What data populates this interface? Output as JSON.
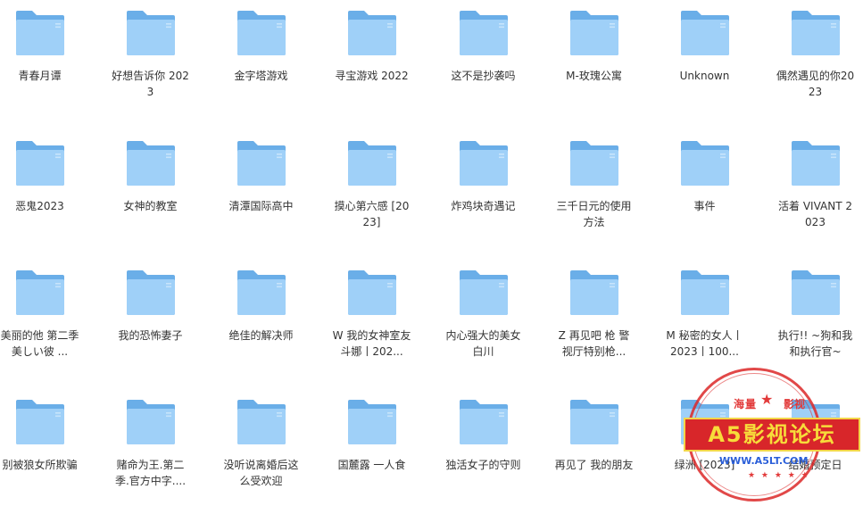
{
  "folders": [
    {
      "label": "青春月谭"
    },
    {
      "label": "好想告诉你 2023"
    },
    {
      "label": "金字塔游戏"
    },
    {
      "label": "寻宝游戏 2022"
    },
    {
      "label": "这不是抄袭吗"
    },
    {
      "label": "M-玫瑰公寓"
    },
    {
      "label": "Unknown"
    },
    {
      "label": "偶然遇见的你2023"
    },
    {
      "label": "恶鬼2023"
    },
    {
      "label": "女神的教室"
    },
    {
      "label": "清潭国际高中"
    },
    {
      "label": "摸心第六感 [2023]"
    },
    {
      "label": "炸鸡块奇遇记"
    },
    {
      "label": "三千日元的使用方法"
    },
    {
      "label": "事件"
    },
    {
      "label": "活着 VIVANT 2023"
    },
    {
      "label": "美丽的他 第二季 美しい彼 ..."
    },
    {
      "label": "我的恐怖妻子"
    },
    {
      "label": "绝佳的解决师"
    },
    {
      "label": "W 我的女神室友斗娜丨202..."
    },
    {
      "label": "内心强大的美女白川"
    },
    {
      "label": "Z 再见吧 枪 警视厅特别枪..."
    },
    {
      "label": "M 秘密的女人丨2023丨100..."
    },
    {
      "label": "执行!! ~狗和我和执行官~"
    },
    {
      "label": "别被狼女所欺骗"
    },
    {
      "label": "赌命为王.第二季.官方中字...."
    },
    {
      "label": "没听说离婚后这么受欢迎"
    },
    {
      "label": "国麓露 一人食"
    },
    {
      "label": "独活女子的守则"
    },
    {
      "label": "再见了 我的朋友"
    },
    {
      "label": "绿洲 [2023]"
    },
    {
      "label": "结婚预定日"
    }
  ],
  "watermark": {
    "top_left": "海量",
    "top_right": "影视",
    "title": "A5影视论坛",
    "url": "WWW.A5LT.COM",
    "dots": "★ ★ ★ ★ ★"
  },
  "colors": {
    "folder_back": "#6aaee8",
    "folder_front": "#9fd0f8",
    "folder_line": "#c7e4fb",
    "label_text": "#333333"
  }
}
